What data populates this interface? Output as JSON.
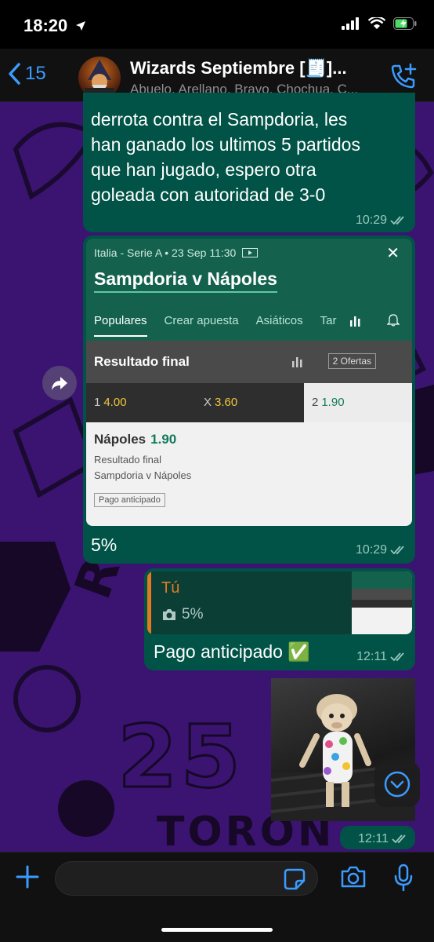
{
  "status_bar": {
    "time": "18:20"
  },
  "header": {
    "back_count": "15",
    "title": "Wizards Septiembre [🧾]...",
    "subtitle": "Abuelo, Arellano, Bravo, Chochua, C..."
  },
  "wallpaper": {
    "text_1": "RAPTORS",
    "text_2": "TORON",
    "text_3": "25"
  },
  "messages": {
    "m1": {
      "lines": [
        "derrota contra el Sampdoria, les",
        "han ganado los ultimos 5 partidos",
        "que han jugado, espero otra",
        "goleada con autoridad de 3-0"
      ],
      "time": "10:29"
    },
    "m2": {
      "card": {
        "league": "Italia - Serie A • 23 Sep 11:30",
        "match": "Sampdoria v Nápoles",
        "tabs": [
          "Populares",
          "Crear apuesta",
          "Asiáticos",
          "Tar"
        ],
        "market": "Resultado final",
        "offers": "2 Ofertas",
        "odds": [
          {
            "label": "1",
            "value": "4.00"
          },
          {
            "label": "X",
            "value": "3.60"
          },
          {
            "label": "2",
            "value": "1.90"
          }
        ],
        "bet_team": "Nápoles",
        "bet_odd": "1.90",
        "bet_market": "Resultado final",
        "bet_match": "Sampdoria v Nápoles",
        "badge": "Pago anticipado"
      },
      "text": "5%",
      "time": "10:29"
    },
    "m3": {
      "quote_author": "Tú",
      "quote_text": "5%",
      "text": "Pago anticipado ✅",
      "time": "12:11"
    },
    "m4": {
      "time": "12:11"
    }
  },
  "colors": {
    "accent": "#3b9bff",
    "bubble": "#005346",
    "wallpaper": "#3a1470"
  }
}
